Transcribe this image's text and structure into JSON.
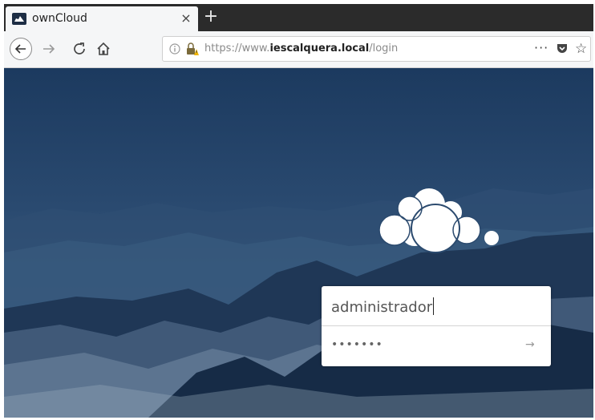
{
  "browser": {
    "tab": {
      "title": "ownCloud",
      "close": "×"
    },
    "new_tab": "+",
    "nav": {
      "back": "back",
      "forward": "forward",
      "reload": "reload",
      "home": "home"
    },
    "url": {
      "prefix": "https://www.",
      "host": "iescalquera.local",
      "path": "/login"
    },
    "page_actions": "···",
    "icons": [
      "info-icon",
      "lock-warning-icon",
      "pocket-icon",
      "bookmark-star-icon"
    ]
  },
  "login": {
    "username": "administrador",
    "password_mask": "•••••••",
    "submit_icon": "→"
  },
  "colors": {
    "background_top": "#1c3a5f",
    "background_bottom": "#1d3555",
    "logo": "#ffffff"
  }
}
